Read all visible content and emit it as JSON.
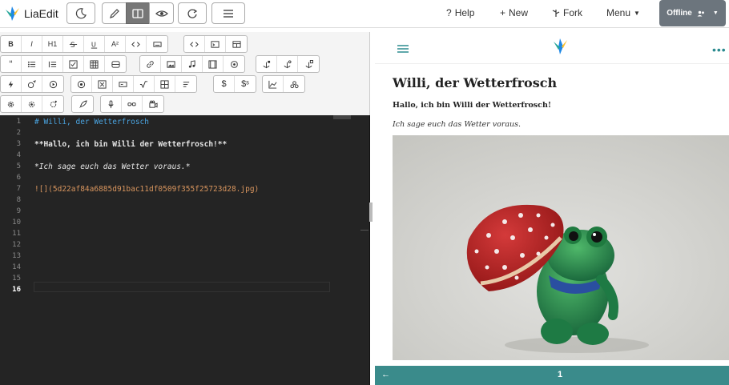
{
  "app": {
    "brand": "LiaEdit"
  },
  "nav": {
    "help": "Help",
    "new": "New",
    "fork": "Fork",
    "menu": "Menu",
    "offline": "Offline"
  },
  "toolbar": {
    "row1": [
      "B",
      "I",
      "H1",
      "",
      "",
      "A²",
      "",
      "",
      "",
      "",
      ""
    ],
    "row2": [
      "“",
      "",
      "",
      "",
      "",
      "",
      "",
      "",
      "",
      "",
      "",
      "",
      "",
      ""
    ],
    "row3": [
      "",
      "",
      "",
      "",
      "",
      "",
      "",
      "",
      "",
      "$",
      "$ˢ",
      "",
      ""
    ],
    "row4": [
      "",
      "",
      "",
      "",
      "",
      "",
      ""
    ]
  },
  "editor": {
    "line_numbers": [
      "1",
      "2",
      "3",
      "4",
      "5",
      "6",
      "7",
      "8",
      "9",
      "10",
      "11",
      "12",
      "13",
      "14",
      "15",
      "16"
    ],
    "current_line": "16",
    "lines": [
      {
        "n": 1,
        "text": "# Willi, der Wetterfrosch",
        "color": "#4aa3df"
      },
      {
        "n": 3,
        "text": "**Hallo, ich bin Willi der Wetterfrosch!**",
        "color": "#e6e6e6"
      },
      {
        "n": 5,
        "text": "*Ich sage euch das Wetter voraus.*",
        "color": "#e6e6e6"
      },
      {
        "n": 7,
        "text": "![](5d22af84a6885d91bac11df0509f355f25723d28.jpg)",
        "color": "#d8955e"
      }
    ]
  },
  "preview": {
    "title": "Willi, der Wetterfrosch",
    "bold_text": "Hallo, ich bin Willi der Wetterfrosch!",
    "italic_text": "Ich sage euch das Wetter voraus.",
    "footer_back": "←",
    "footer_page": "1",
    "accent_color": "#3a8b8b"
  }
}
